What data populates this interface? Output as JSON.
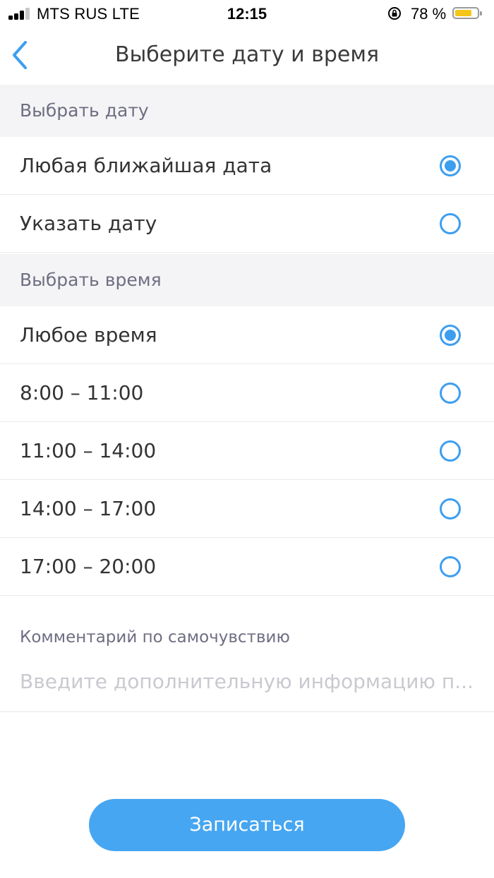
{
  "status_bar": {
    "carrier": "MTS RUS   LTE",
    "time": "12:15",
    "battery_percent": "78 %",
    "battery_level": 0.78
  },
  "nav": {
    "title": "Выберите дату и время",
    "back_icon": "chevron-left-icon"
  },
  "date_section": {
    "header": "Выбрать дату",
    "options": [
      {
        "label": "Любая ближайшая дата",
        "selected": true
      },
      {
        "label": "Указать дату",
        "selected": false
      }
    ]
  },
  "time_section": {
    "header": "Выбрать время",
    "options": [
      {
        "label": "Любое время",
        "selected": true
      },
      {
        "label": "8:00 – 11:00",
        "selected": false
      },
      {
        "label": "11:00 – 14:00",
        "selected": false
      },
      {
        "label": "14:00 – 17:00",
        "selected": false
      },
      {
        "label": "17:00 – 20:00",
        "selected": false
      }
    ]
  },
  "comment": {
    "label": "Комментарий по самочувствию",
    "placeholder": "Введите дополнительную информацию п...",
    "value": ""
  },
  "submit": {
    "label": "Записаться"
  },
  "colors": {
    "accent": "#3d9ef0",
    "button": "#46a6f2",
    "battery": "#f5c518"
  }
}
